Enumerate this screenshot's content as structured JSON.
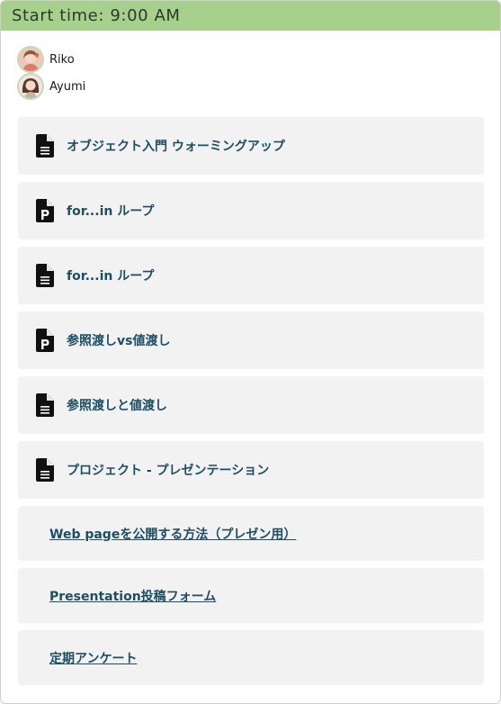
{
  "header": {
    "start_time": "Start time: 9:00 AM"
  },
  "people": [
    {
      "name": "Riko",
      "avatar": "avatar-photo-riko"
    },
    {
      "name": "Ayumi",
      "avatar": "avatar-photo-ayumi"
    }
  ],
  "items": [
    {
      "title": "オブジェクト入門 ウォーミングアップ",
      "icon": "document-icon"
    },
    {
      "title": "for...in ループ",
      "icon": "presentation-icon"
    },
    {
      "title": "for...in ループ",
      "icon": "document-icon"
    },
    {
      "title": "参照渡しvs値渡し",
      "icon": "presentation-icon"
    },
    {
      "title": "参照渡しと値渡し",
      "icon": "document-icon"
    },
    {
      "title": "プロジェクト - プレゼンテーション",
      "icon": "document-icon"
    }
  ],
  "links": [
    {
      "title": "Web pageを公開する方法（プレゼン用）"
    },
    {
      "title": "Presentation投稿フォーム"
    },
    {
      "title": "定期アンケート"
    }
  ],
  "colors": {
    "header_bg": "#a6d08c",
    "card_bg": "#f2f2f2",
    "title_text": "#1d4e63"
  }
}
